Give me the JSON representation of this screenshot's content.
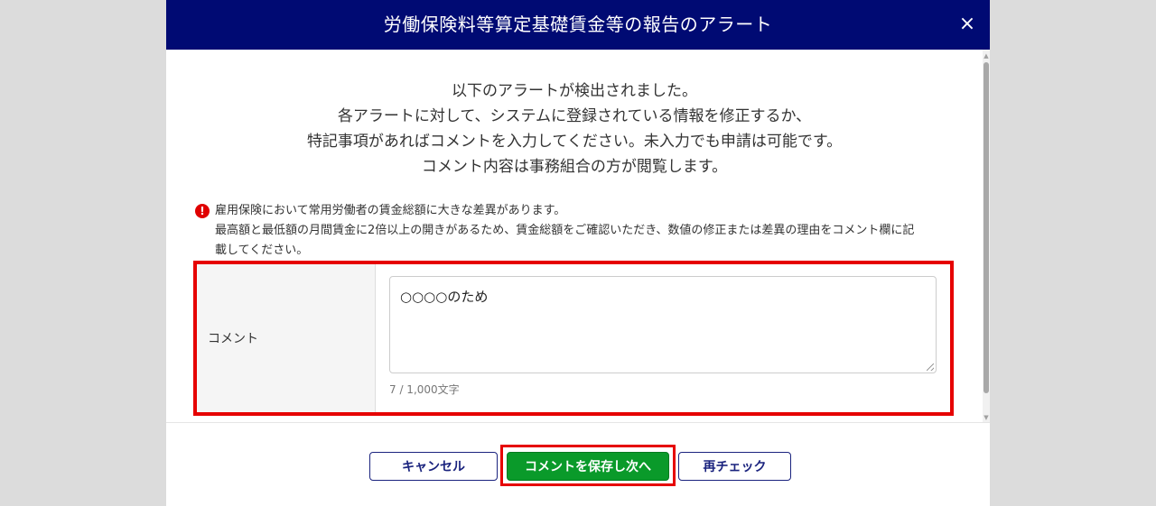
{
  "modal": {
    "title": "労働保険料等算定基礎賃金等の報告のアラート",
    "close_label": "×"
  },
  "intro": {
    "lines": [
      "以下のアラートが検出されました。",
      "各アラートに対して、システムに登録されている情報を修正するか、",
      "特記事項があればコメントを入力してください。未入力でも申請は可能です。",
      "コメント内容は事務組合の方が閲覧します。"
    ]
  },
  "alert": {
    "icon": "exclamation-icon",
    "icon_glyph": "!",
    "title": "雇用保険において常用労働者の賃金総額に大きな差異があります。",
    "message": "最高額と最低額の月間賃金に2倍以上の開きがあるため、賃金総額をご確認いただき、数値の修正または差異の理由をコメント欄に記",
    "message_cont": "載してください。"
  },
  "comment": {
    "label": "コメント",
    "value": "○○○○のため",
    "char_count": "7 / 1,000文字"
  },
  "footer": {
    "cancel_label": "キャンセル",
    "save_label": "コメントを保存し次へ",
    "recheck_label": "再チェック"
  },
  "colors": {
    "header_bg": "#000a73",
    "highlight": "#e60000",
    "save_button": "#0a9a2a",
    "alert_icon": "#e00000",
    "outline_button": "#1a237e"
  }
}
